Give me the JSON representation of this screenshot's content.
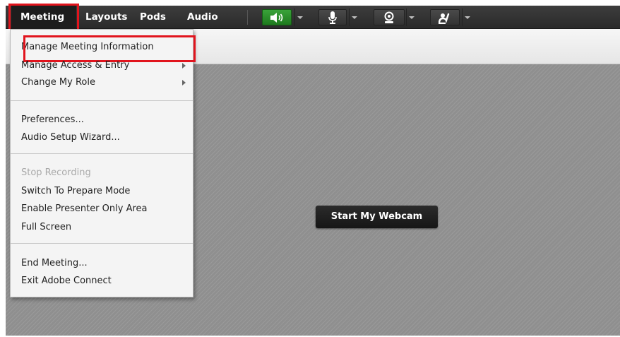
{
  "menubar": {
    "items": [
      {
        "label": "Meeting"
      },
      {
        "label": "Layouts"
      },
      {
        "label": "Pods"
      },
      {
        "label": "Audio"
      }
    ],
    "toolbar": {
      "speaker_icon": "speaker-icon",
      "microphone_icon": "microphone-icon",
      "webcam_icon": "webcam-icon",
      "raise_hand_icon": "raise-hand-icon"
    }
  },
  "dropdown": {
    "groups": [
      [
        {
          "label": "Manage Meeting Information"
        },
        {
          "label": "Manage Access & Entry"
        },
        {
          "label": "Change My Role"
        }
      ],
      [
        {
          "label": "Preferences..."
        },
        {
          "label": "Audio Setup Wizard..."
        }
      ],
      [
        {
          "label": "Stop Recording"
        },
        {
          "label": "Switch To Prepare Mode"
        },
        {
          "label": "Enable Presenter Only Area"
        },
        {
          "label": "Full Screen"
        }
      ],
      [
        {
          "label": "End Meeting..."
        },
        {
          "label": "Exit Adobe Connect"
        }
      ]
    ]
  },
  "stage": {
    "webcam_button": "Start My Webcam"
  },
  "colors": {
    "highlight": "#e1141d",
    "menubar": "#2f2f2f",
    "speaker_active": "#2e8f2e",
    "stage": "#8f8f8f"
  }
}
